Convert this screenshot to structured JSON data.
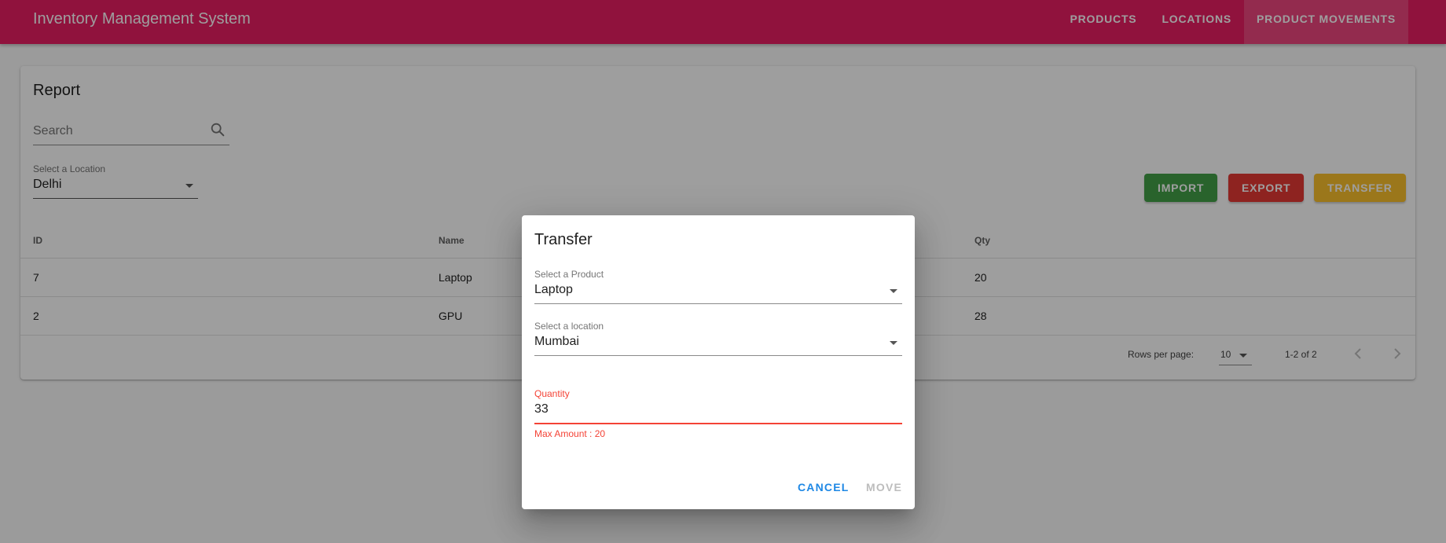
{
  "app": {
    "title": "Inventory Management System"
  },
  "nav": {
    "items": [
      "PRODUCTS",
      "LOCATIONS",
      "PRODUCT MOVEMENTS"
    ],
    "active": "PRODUCT MOVEMENTS"
  },
  "report": {
    "title": "Report",
    "search": {
      "placeholder": "Search",
      "icon": "search-icon"
    },
    "location": {
      "label": "Select a Location",
      "value": "Delhi"
    },
    "buttons": {
      "import": "IMPORT",
      "export": "EXPORT",
      "transfer": "TRANSFER"
    },
    "table": {
      "columns": [
        "ID",
        "Name",
        "Qty"
      ],
      "rows": [
        {
          "id": "7",
          "name": "Laptop",
          "qty": "20"
        },
        {
          "id": "2",
          "name": "GPU",
          "qty": "28"
        }
      ]
    },
    "pagination": {
      "rows_per_page_label": "Rows per page:",
      "rows_per_page": "10",
      "range": "1-2 of 2"
    }
  },
  "dialog": {
    "title": "Transfer",
    "product": {
      "label": "Select a Product",
      "value": "Laptop"
    },
    "location": {
      "label": "Select a location",
      "value": "Mumbai"
    },
    "quantity": {
      "label": "Quantity",
      "value": "33",
      "error": "Max Amount : 20"
    },
    "actions": {
      "cancel": "CANCEL",
      "move": "MOVE"
    }
  },
  "colors": {
    "primary": "#e91e63",
    "import": "#43a047",
    "export": "#e53935",
    "transfer": "#fbc02d",
    "error": "#f44336",
    "accent": "#1e88e5"
  }
}
